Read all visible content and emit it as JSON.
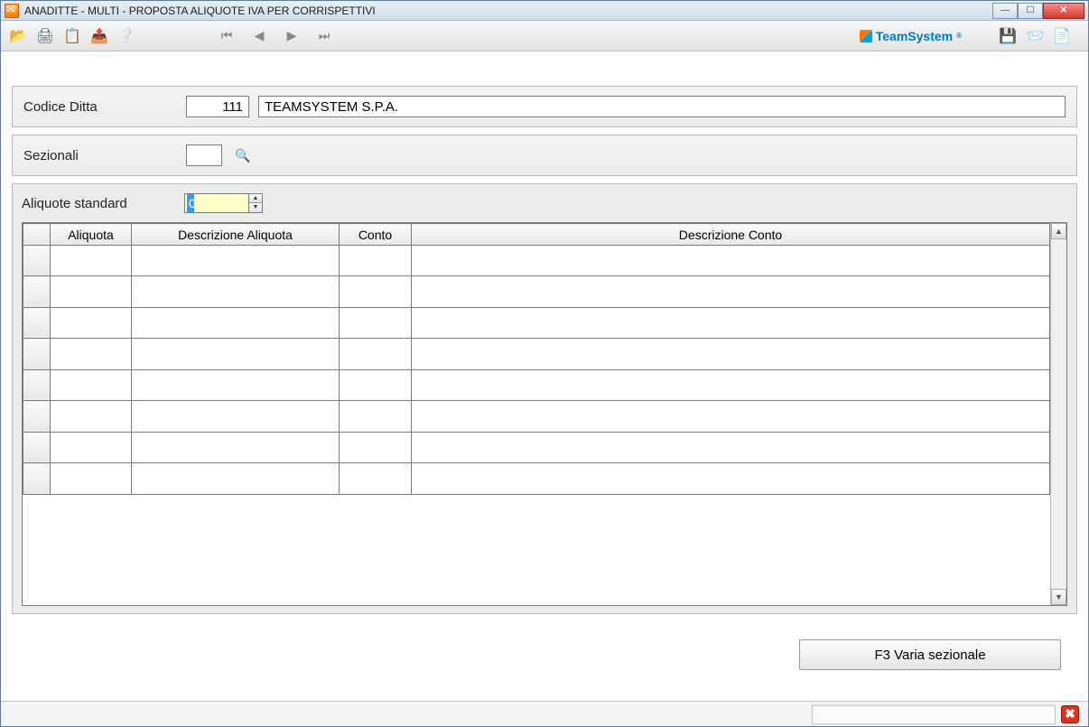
{
  "window": {
    "title": "ANADITTE  - MULTI -  PROPOSTA ALIQUOTE IVA PER CORRISPETTIVI"
  },
  "brand": {
    "name": "TeamSystem",
    "reg": "®"
  },
  "company": {
    "label": "Codice Ditta",
    "code": "111",
    "name": "TEAMSYSTEM S.P.A."
  },
  "sezionali": {
    "label": "Sezionali",
    "value": ""
  },
  "aliquote": {
    "label": "Aliquote standard",
    "value": "0"
  },
  "grid": {
    "headers": {
      "aliquota": "Aliquota",
      "descr_aliq": "Descrizione Aliquota",
      "conto": "Conto",
      "descr_conto": "Descrizione Conto"
    },
    "rows": [
      {
        "aliquota": "",
        "descr_aliq": "",
        "conto": "",
        "descr_conto": ""
      },
      {
        "aliquota": "",
        "descr_aliq": "",
        "conto": "",
        "descr_conto": ""
      },
      {
        "aliquota": "",
        "descr_aliq": "",
        "conto": "",
        "descr_conto": ""
      },
      {
        "aliquota": "",
        "descr_aliq": "",
        "conto": "",
        "descr_conto": ""
      },
      {
        "aliquota": "",
        "descr_aliq": "",
        "conto": "",
        "descr_conto": ""
      },
      {
        "aliquota": "",
        "descr_aliq": "",
        "conto": "",
        "descr_conto": ""
      },
      {
        "aliquota": "",
        "descr_aliq": "",
        "conto": "",
        "descr_conto": ""
      },
      {
        "aliquota": "",
        "descr_aliq": "",
        "conto": "",
        "descr_conto": ""
      }
    ]
  },
  "buttons": {
    "varia_sezionale": "F3 Varia sezionale"
  },
  "icons": {
    "open": "📂",
    "print": "🖨",
    "copy": "📋",
    "export": "📤",
    "help": "❔",
    "first": "⏮",
    "prev": "◀",
    "next": "▶",
    "last": "⏭",
    "save": "💾",
    "send": "📨",
    "list": "📄",
    "lookup": "🔍",
    "close": "✖",
    "up": "▲",
    "down": "▼"
  }
}
